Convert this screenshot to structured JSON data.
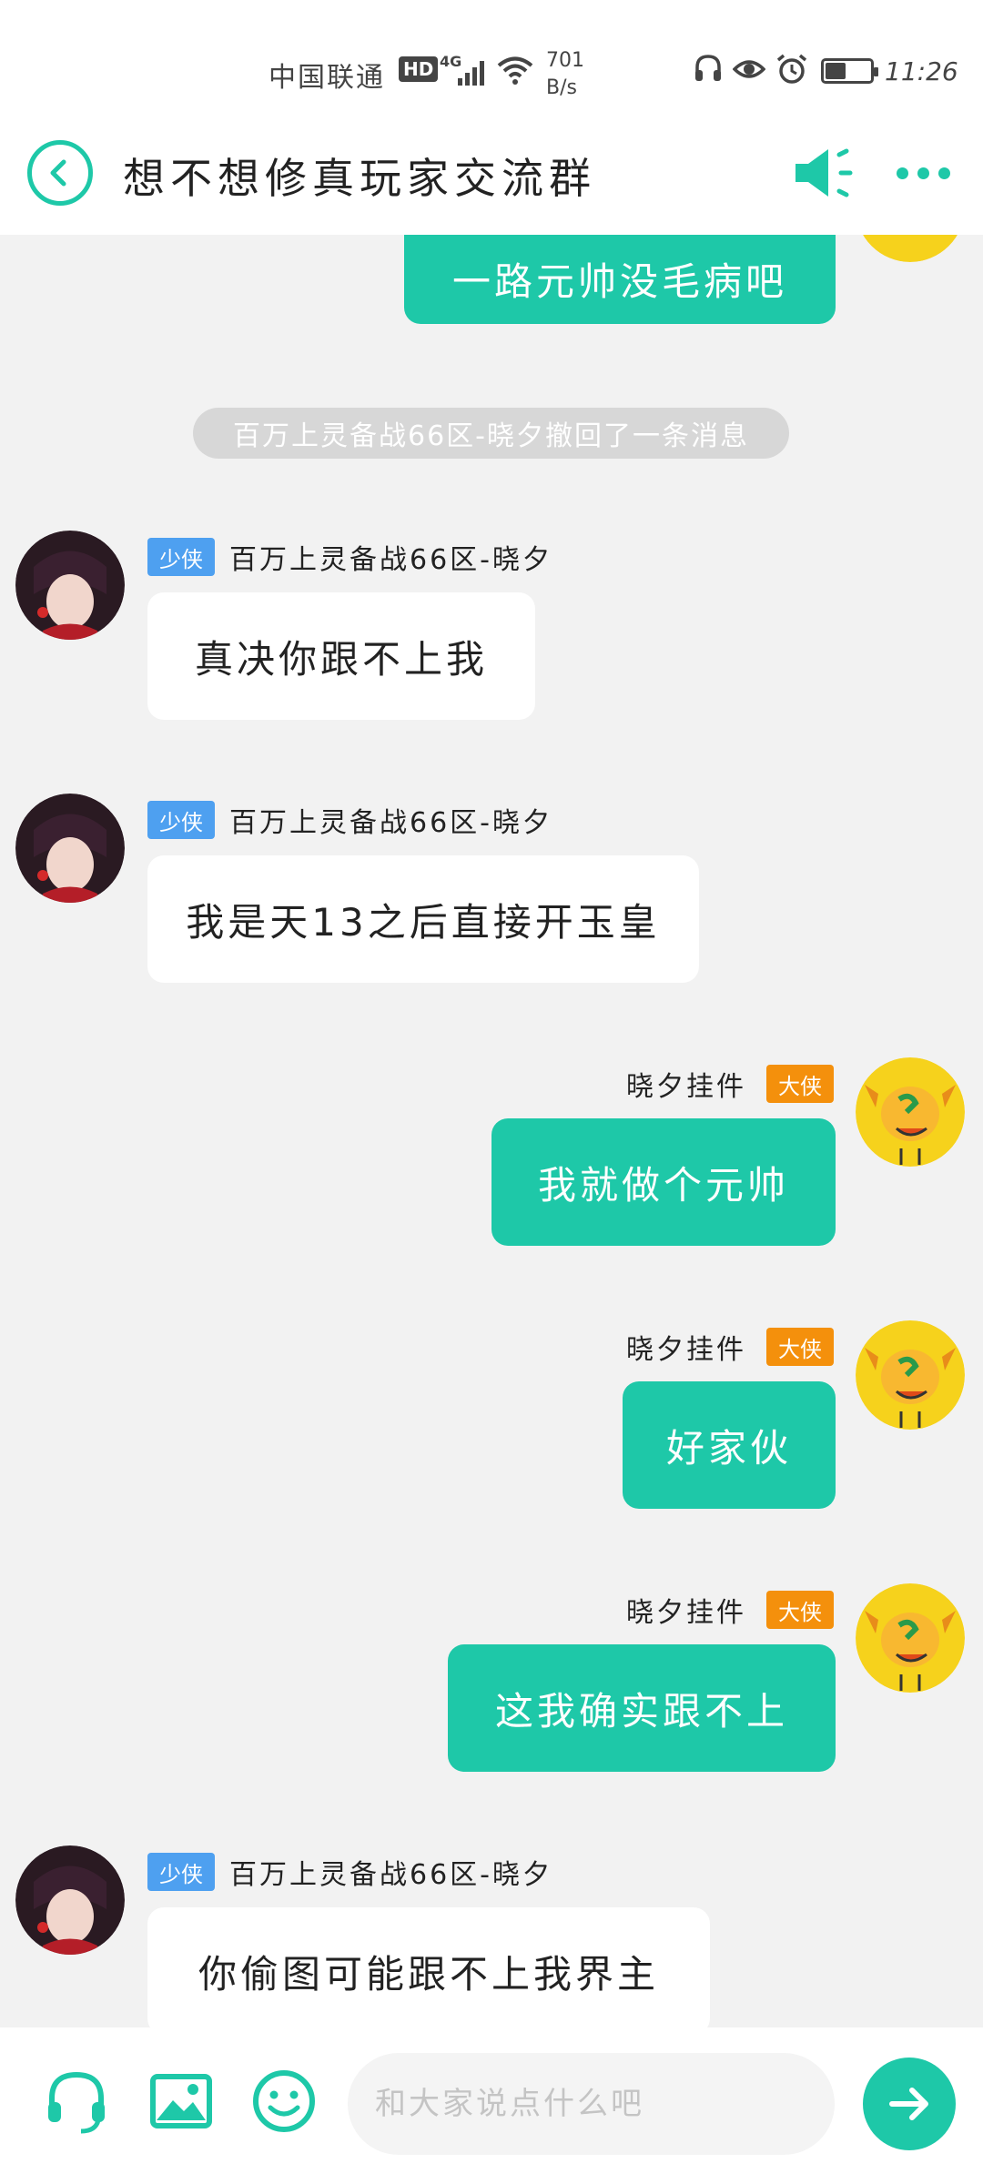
{
  "status_bar": {
    "carrier": "中国联通",
    "hd": "HD",
    "network": "4G",
    "speed_value": "701",
    "speed_unit": "B/s",
    "battery_level": 0.45,
    "time": "11:26"
  },
  "header": {
    "title": "想不想修真玩家交流群",
    "back_icon": "back-arrow-icon",
    "voice_icon": "speaker-icon",
    "more_icon": "more-dots-icon"
  },
  "messages": [
    {
      "side": "me",
      "text": "一路元帅没毛病吧"
    },
    {
      "side": "system",
      "text": "百万上灵备战66区-晓夕撤回了一条消息"
    },
    {
      "side": "other",
      "badge": "少侠",
      "sender": "百万上灵备战66区-晓夕",
      "text": "真决你跟不上我"
    },
    {
      "side": "other",
      "badge": "少侠",
      "sender": "百万上灵备战66区-晓夕",
      "text": "我是天13之后直接开玉皇"
    },
    {
      "side": "me",
      "badge": "大侠",
      "sender": "晓夕挂件",
      "text": "我就做个元帅"
    },
    {
      "side": "me",
      "badge": "大侠",
      "sender": "晓夕挂件",
      "text": "好家伙"
    },
    {
      "side": "me",
      "badge": "大侠",
      "sender": "晓夕挂件",
      "text": "这我确实跟不上"
    },
    {
      "side": "other",
      "badge": "少侠",
      "sender": "百万上灵备战66区-晓夕",
      "text": "你偷图可能跟不上我界主"
    }
  ],
  "input_bar": {
    "placeholder": "和大家说点什么吧",
    "icons": [
      "headset-icon",
      "image-icon",
      "emoji-icon",
      "send-arrow-icon"
    ]
  },
  "colors": {
    "accent": "#1ec8a8",
    "badge_shaoxia": "#4ea0f0",
    "badge_daxia": "#f4900c",
    "background": "#f2f2f2"
  }
}
